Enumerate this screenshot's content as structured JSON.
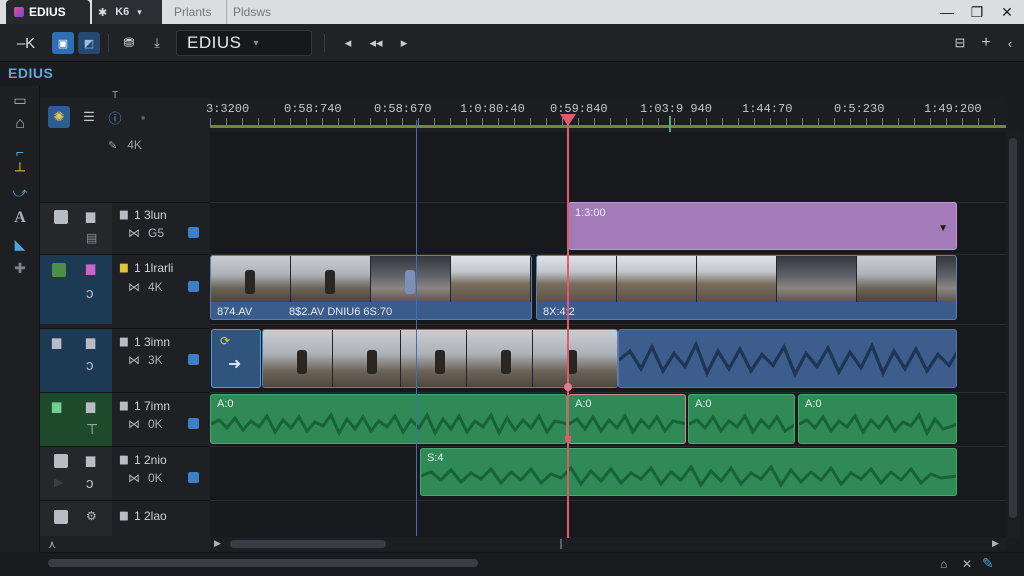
{
  "titlebar": {
    "tab_active": "EDIUS",
    "tab2_text": "K6",
    "tab3": "Prlants",
    "tab4": "Pldsws",
    "minimize": "—",
    "maximize": "❐",
    "close": "✕"
  },
  "toolbar": {
    "left_label": "–K",
    "project_combo": "EDIUS",
    "combo_arrow": "▾"
  },
  "sidebar": {
    "app_label": "EDIUS"
  },
  "track_panel": {
    "top_indicator": "T",
    "resolution": "4K"
  },
  "tracks": [
    {
      "name": "1 3lun",
      "sub": "G5"
    },
    {
      "name": "1 1lrarli",
      "sub": "4K"
    },
    {
      "name": "1 3imn",
      "sub": "3K"
    },
    {
      "name": "1 7imn",
      "sub": "0K"
    },
    {
      "name": "1 2nio",
      "sub": "0K"
    },
    {
      "name": "1 2lao",
      "sub": ""
    }
  ],
  "ruler": {
    "labels": [
      "3:3200",
      "0:58:740",
      "0:58:670",
      "1:0:80:40",
      "0:59:840",
      "1:03:9 940",
      "1:44:70",
      "0:5:230",
      "1:49:200"
    ]
  },
  "clips": {
    "title_clip": "1:3:00",
    "video_a": "874.AV",
    "video_b": "8$2.AV DNIU6 6S:70",
    "video_c": "8X:4:2",
    "audio_1": "A:0",
    "audio_2": "A:0",
    "audio_3": "A:0",
    "audio_4": "A:0",
    "audio_5": "S:4"
  },
  "colors": {
    "accent": "#3b80c8",
    "playhead": "#e05a6a",
    "title_clip": "#a27bb8",
    "video_clip": "#3b5c8a",
    "audio_clip": "#2f8a55",
    "ruler_bar": "#6f8b2a"
  }
}
